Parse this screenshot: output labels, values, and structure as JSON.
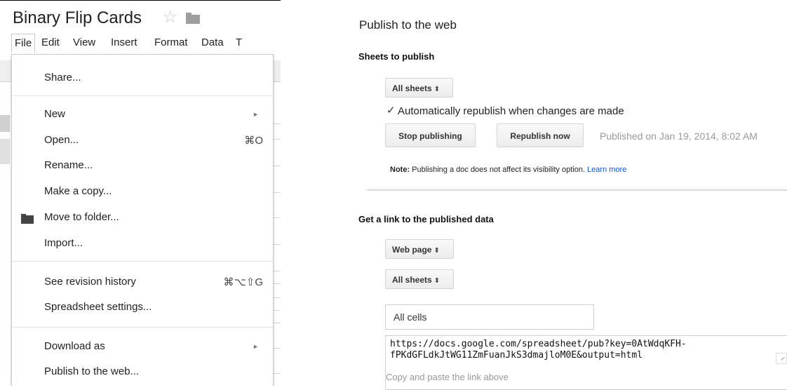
{
  "spreadsheet": {
    "title": "Binary Flip Cards",
    "menubar": [
      "File",
      "Edit",
      "View",
      "Insert",
      "Format",
      "Data",
      "T"
    ]
  },
  "file_menu": {
    "share": "Share...",
    "new": "New",
    "open": "Open...",
    "open_shortcut": "⌘O",
    "rename": "Rename...",
    "make_copy": "Make a copy...",
    "move_to_folder": "Move to folder...",
    "import": "Import...",
    "revision_history": "See revision history",
    "revision_shortcut": "⌘⌥⇧G",
    "spreadsheet_settings": "Spreadsheet settings...",
    "download_as": "Download as",
    "publish": "Publish to the web..."
  },
  "publish": {
    "title": "Publish to the web",
    "sheets_heading": "Sheets to publish",
    "sheets_select": "All sheets",
    "auto_republish_label": "Automatically republish when changes are made",
    "auto_republish_checked": true,
    "stop_button": "Stop publishing",
    "republish_button": "Republish now",
    "published_status": "Published on Jan 19, 2014, 8:02 AM",
    "note_label": "Note:",
    "note_text": " Publishing a doc does not affect its visibility option. ",
    "learn_more": "Learn more",
    "link_heading": "Get a link to the published data",
    "format_select": "Web page",
    "link_sheets_select": "All sheets",
    "cells_value": "All cells",
    "url_line1": "https://docs.google.com/spreadsheet/pub?key=0AtWdqKFH-",
    "url_line2": "fPKdGFLdkJtWG11ZmFuanJkS3dmajloM0E&output=html",
    "copy_hint": "Copy and paste the link above"
  }
}
